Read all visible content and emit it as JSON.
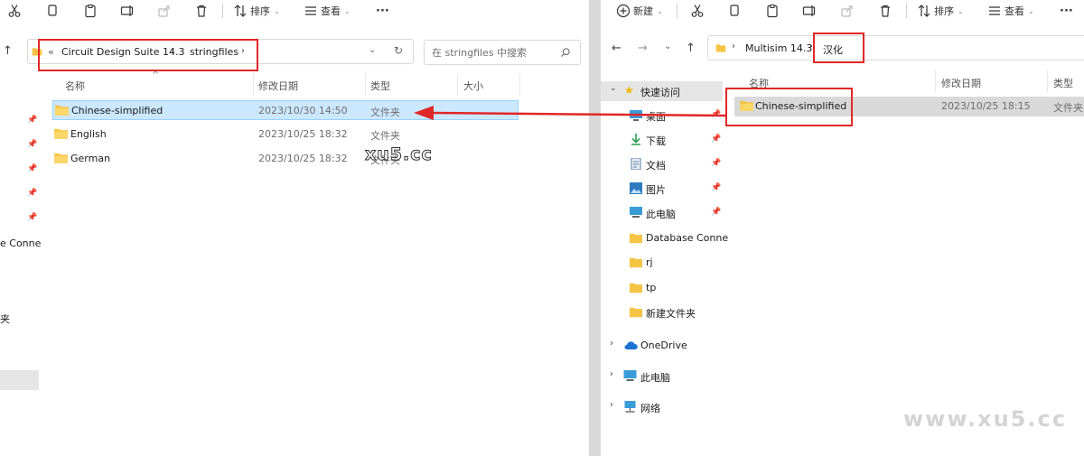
{
  "toolbar": {
    "sort_label": "排序",
    "view_label": "查看",
    "new_label": "新建",
    "more_label": "···"
  },
  "left": {
    "breadcrumb": {
      "prefix": "«",
      "segments": [
        "Circuit Design Suite 14.3",
        "stringfiles"
      ]
    },
    "search_placeholder": "在 stringfiles 中搜索",
    "columns": {
      "name": "名称",
      "date": "修改日期",
      "type": "类型",
      "size": "大小"
    },
    "files": [
      {
        "name": "Chinese-simplified",
        "date": "2023/10/30 14:50",
        "type": "文件夹"
      },
      {
        "name": "English",
        "date": "2023/10/25 18:32",
        "type": "文件夹"
      },
      {
        "name": "German",
        "date": "2023/10/25 18:32",
        "type": "文件夹"
      }
    ],
    "nav_fragments": [
      "e Conne",
      "夹"
    ]
  },
  "right": {
    "breadcrumb": {
      "segments": [
        "Multisim 14.3",
        "汉化"
      ]
    },
    "columns": {
      "name": "名称",
      "date": "修改日期",
      "type": "类型"
    },
    "files": [
      {
        "name": "Chinese-simplified",
        "date": "2023/10/25 18:15",
        "type": "文件夹"
      }
    ],
    "nav": {
      "quick_access": "快速访问",
      "items": [
        "桌面",
        "下载",
        "文档",
        "图片",
        "此电脑",
        "Database Conne",
        "rj",
        "tp",
        "新建文件夹"
      ],
      "onedrive": "OneDrive",
      "this_pc": "此电脑",
      "network": "网络"
    }
  },
  "watermarks": {
    "center": "xu5.cc",
    "corner": "www.xu5.cc"
  },
  "colors": {
    "accent_red": "#e02828",
    "selection": "#cce8ff",
    "folder": "#f6c445"
  }
}
